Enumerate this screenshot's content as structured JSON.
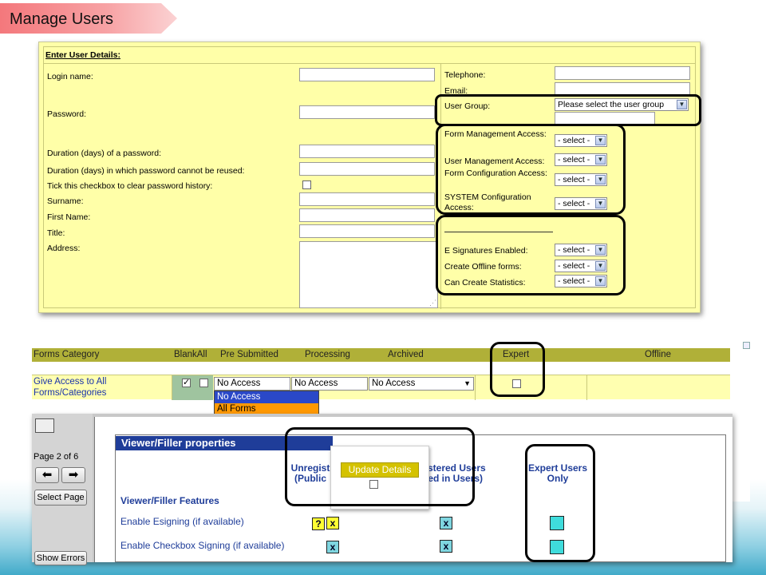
{
  "page_title": "Manage Users",
  "user_details": {
    "header": "Enter User Details:",
    "login_name": "Login name:",
    "password": "Password:",
    "password_duration": "Duration (days) of a password:",
    "password_reuse": "Duration (days) in which password cannot be reused:",
    "clear_history": "Tick this checkbox to clear password history:",
    "surname": "Surname:",
    "first_name": "First Name:",
    "title": "Title:",
    "address": "Address:",
    "telephone": "Telephone:",
    "email": "Email:",
    "user_group": "User Group:",
    "user_group_value": "Please select the user group",
    "form_management": "Form Management Access:",
    "user_management": "User Management Access:",
    "form_configuration": "Form Configuration Access:",
    "system_configuration": "SYSTEM Configuration Access:",
    "e_signatures": "E Signatures Enabled:",
    "offline_forms": "Create Offline forms:",
    "statistics": "Can Create Statistics:",
    "select_value": "- select -"
  },
  "forms_category": {
    "headers": {
      "category": "Forms Category",
      "blank_all": "BlankAll",
      "pre_submitted": "Pre Submitted",
      "processing": "Processing",
      "archived": "Archived",
      "expert": "Expert",
      "offline": "Offline"
    },
    "row_label": "Give Access to All Forms/Categories",
    "pre_submitted_value": "No Access",
    "processing_value": "No Access",
    "archived_value": "No Access",
    "dropdown_options": [
      "No Access",
      "All Forms"
    ]
  },
  "viewer_filler": {
    "page_label": "Page 2 of 6",
    "select_page": "Select Page",
    "show_errors": "Show Errors",
    "title": "Viewer/Filler properties",
    "col_unregistered": "Unregist (Public",
    "col_registered": "gistered Users ged in Users)",
    "col_expert": "Expert Users Only",
    "section_label": "Viewer/Filler Features",
    "feature_esigning": "Enable Esigning (if available)",
    "feature_checkbox": "Enable Checkbox Signing (if available)",
    "update_button": "Update Details",
    "help_mark": "?",
    "x_mark": "x"
  }
}
